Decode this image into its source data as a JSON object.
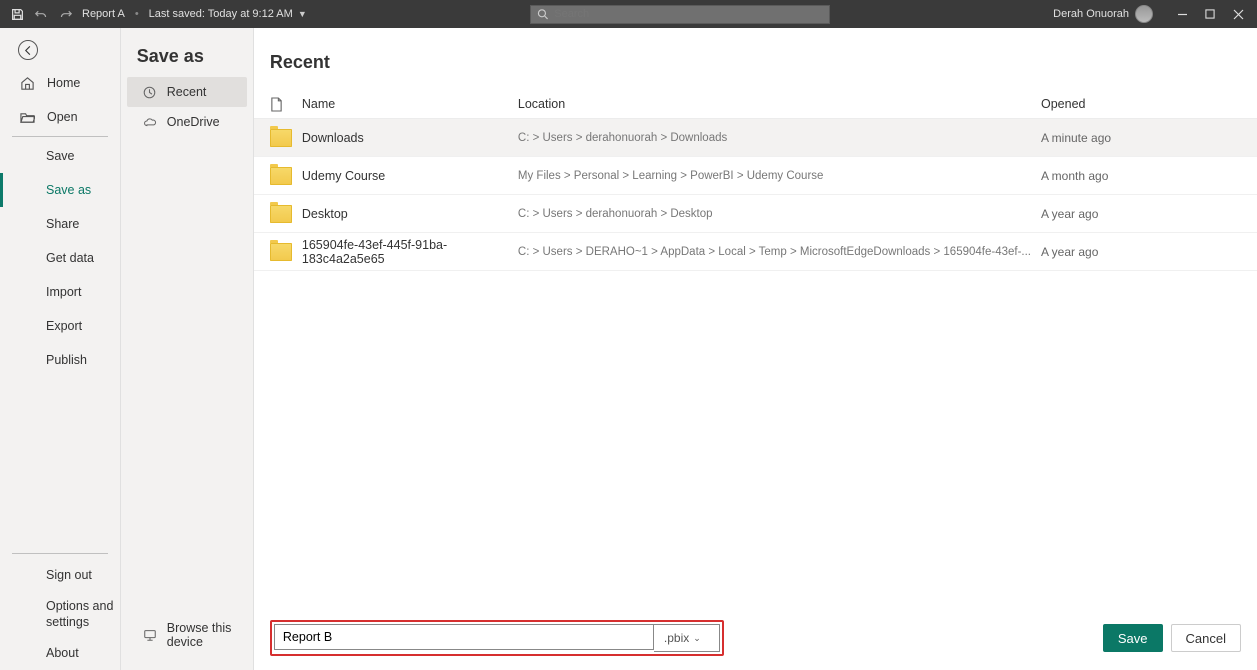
{
  "titlebar": {
    "doc_title": "Report A",
    "saved_text": "Last saved: Today at 9:12 AM",
    "search_placeholder": "Search",
    "user_name": "Derah Onuorah"
  },
  "left_nav": {
    "home": "Home",
    "open": "Open",
    "save": "Save",
    "save_as": "Save as",
    "share": "Share",
    "get_data": "Get data",
    "import": "Import",
    "export": "Export",
    "publish": "Publish",
    "sign_out": "Sign out",
    "options": "Options and settings",
    "about": "About"
  },
  "second_col": {
    "title": "Save as",
    "recent": "Recent",
    "onedrive": "OneDrive",
    "browse": "Browse this device"
  },
  "main": {
    "title": "Recent",
    "headers": {
      "name": "Name",
      "location": "Location",
      "opened": "Opened"
    },
    "rows": [
      {
        "name": "Downloads",
        "location": "C: > Users > derahonuorah > Downloads",
        "opened": "A minute ago"
      },
      {
        "name": "Udemy Course",
        "location": "My Files > Personal > Learning > PowerBI > Udemy Course",
        "opened": "A month ago"
      },
      {
        "name": "Desktop",
        "location": "C: > Users > derahonuorah > Desktop",
        "opened": "A year ago"
      },
      {
        "name": "165904fe-43ef-445f-91ba-183c4a2a5e65",
        "location": "C: > Users > DERAHO~1 > AppData > Local > Temp > MicrosoftEdgeDownloads > 165904fe-43ef-...",
        "opened": "A year ago"
      }
    ],
    "filename": "Report B",
    "extension": ".pbix",
    "save_btn": "Save",
    "cancel_btn": "Cancel"
  }
}
